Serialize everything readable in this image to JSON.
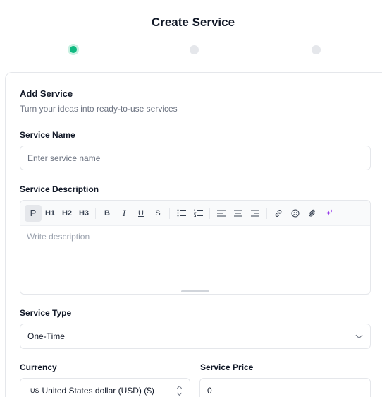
{
  "page": {
    "title": "Create Service"
  },
  "stepper": {
    "current_step": 1,
    "total_steps": 3,
    "accent_color": "#10b981"
  },
  "card": {
    "title": "Add Service",
    "subtitle": "Turn your ideas into ready-to-use services"
  },
  "service_name": {
    "label": "Service Name",
    "placeholder": "Enter service name",
    "value": ""
  },
  "service_description": {
    "label": "Service Description",
    "placeholder": "Write description",
    "toolbar": {
      "paragraph": "P",
      "h1": "H1",
      "h2": "H2",
      "h3": "H3",
      "bold": "B",
      "italic": "I",
      "underline": "U",
      "strike": "S"
    }
  },
  "service_type": {
    "label": "Service Type",
    "value": "One-Time"
  },
  "currency": {
    "label": "Currency",
    "code": "US",
    "value": "United States dollar (USD) ($)"
  },
  "service_price": {
    "label": "Service Price",
    "value": "0"
  }
}
